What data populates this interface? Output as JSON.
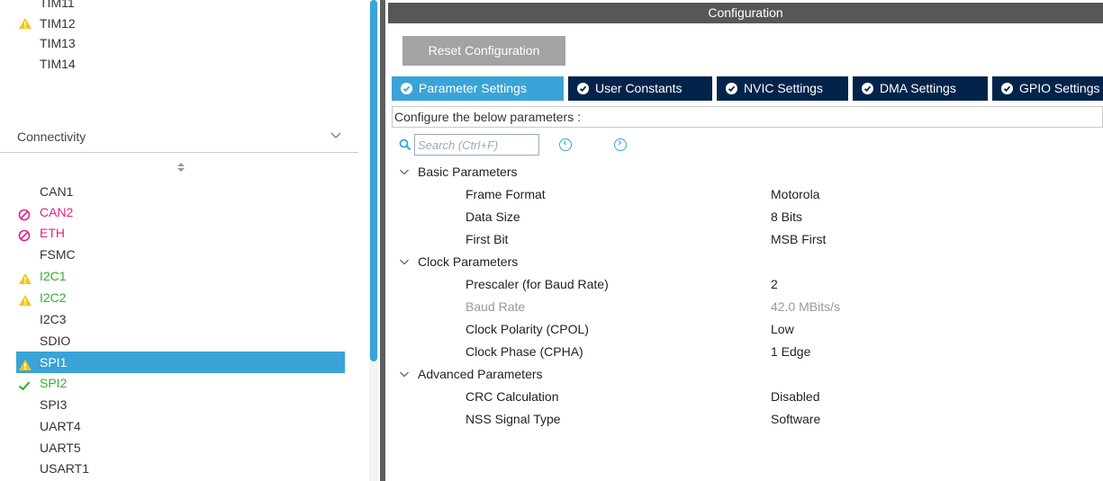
{
  "timers": {
    "items": [
      {
        "label": "TIM11",
        "status": "none"
      },
      {
        "label": "TIM12",
        "status": "warning"
      },
      {
        "label": "TIM13",
        "status": "none"
      },
      {
        "label": "TIM14",
        "status": "none"
      }
    ]
  },
  "connectivity": {
    "title": "Connectivity",
    "items": [
      {
        "label": "CAN1",
        "status": "none"
      },
      {
        "label": "CAN2",
        "status": "disabled"
      },
      {
        "label": "ETH",
        "status": "disabled"
      },
      {
        "label": "FSMC",
        "status": "none"
      },
      {
        "label": "I2C1",
        "status": "warning"
      },
      {
        "label": "I2C2",
        "status": "warning"
      },
      {
        "label": "I2C3",
        "status": "none"
      },
      {
        "label": "SDIO",
        "status": "none"
      },
      {
        "label": "SPI1",
        "status": "warning-selected"
      },
      {
        "label": "SPI2",
        "status": "ok"
      },
      {
        "label": "SPI3",
        "status": "none"
      },
      {
        "label": "UART4",
        "status": "none"
      },
      {
        "label": "UART5",
        "status": "none"
      },
      {
        "label": "USART1",
        "status": "none"
      }
    ]
  },
  "configuration": {
    "title": "Configuration",
    "reset_label": "Reset Configuration",
    "tabs": [
      {
        "label": "Parameter Settings",
        "active": true
      },
      {
        "label": "User Constants",
        "active": false
      },
      {
        "label": "NVIC Settings",
        "active": false
      },
      {
        "label": "DMA Settings",
        "active": false
      },
      {
        "label": "GPIO Settings",
        "active": false
      }
    ],
    "note": "Configure the below parameters :",
    "search_placeholder": "Search (Ctrl+F)",
    "groups": [
      {
        "title": "Basic Parameters",
        "params": [
          {
            "name": "Frame Format",
            "value": "Motorola",
            "disabled": false
          },
          {
            "name": "Data Size",
            "value": "8 Bits",
            "disabled": false
          },
          {
            "name": "First Bit",
            "value": "MSB First",
            "disabled": false
          }
        ]
      },
      {
        "title": "Clock Parameters",
        "params": [
          {
            "name": "Prescaler (for Baud Rate)",
            "value": "2",
            "disabled": false
          },
          {
            "name": "Baud Rate",
            "value": "42.0 MBits/s",
            "disabled": true
          },
          {
            "name": "Clock Polarity (CPOL)",
            "value": "Low",
            "disabled": false
          },
          {
            "name": "Clock Phase (CPHA)",
            "value": "1 Edge",
            "disabled": false
          }
        ]
      },
      {
        "title": "Advanced Parameters",
        "params": [
          {
            "name": "CRC Calculation",
            "value": "Disabled",
            "disabled": false
          },
          {
            "name": "NSS Signal Type",
            "value": "Software",
            "disabled": false
          }
        ]
      }
    ]
  },
  "colors": {
    "accent": "#3aa3d8",
    "tab_dark": "#03234b",
    "warning": "#f5c518",
    "error": "#e0208a",
    "ok": "#2fae2f"
  }
}
